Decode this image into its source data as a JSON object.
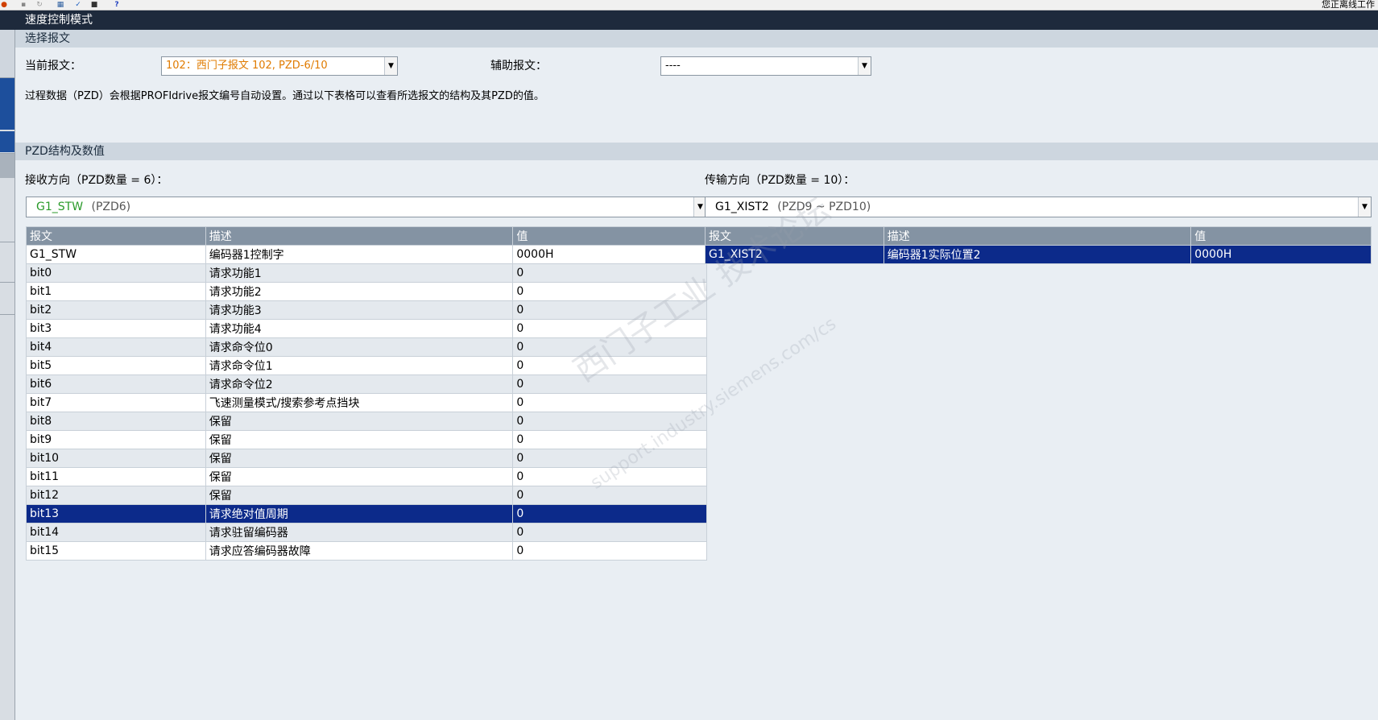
{
  "toolbar": {
    "status": "您正离线工作"
  },
  "title": "速度控制模式",
  "select_section": {
    "header": "选择报文",
    "current_label": "当前报文：",
    "current_value": "102：西门子报文 102, PZD-6/10",
    "aux_label": "辅助报文：",
    "aux_value": "----",
    "info": "过程数据（PZD）会根据PROFIdrive报文编号自动设置。通过以下表格可以查看所选报文的结构及其PZD的值。"
  },
  "pzd_section": {
    "header": "PZD结构及数值",
    "receive": {
      "label": "接收方向（PZD数量 = 6）：",
      "combo_name": "G1_STW",
      "combo_suffix": "(PZD6)",
      "columns": [
        "报文",
        "描述",
        "值"
      ],
      "rows": [
        [
          "G1_STW",
          "编码器1控制字",
          "0000H"
        ],
        [
          "bit0",
          "请求功能1",
          "0"
        ],
        [
          "bit1",
          "请求功能2",
          "0"
        ],
        [
          "bit2",
          "请求功能3",
          "0"
        ],
        [
          "bit3",
          "请求功能4",
          "0"
        ],
        [
          "bit4",
          "请求命令位0",
          "0"
        ],
        [
          "bit5",
          "请求命令位1",
          "0"
        ],
        [
          "bit6",
          "请求命令位2",
          "0"
        ],
        [
          "bit7",
          "飞速测量模式/搜索参考点挡块",
          "0"
        ],
        [
          "bit8",
          "保留",
          "0"
        ],
        [
          "bit9",
          "保留",
          "0"
        ],
        [
          "bit10",
          "保留",
          "0"
        ],
        [
          "bit11",
          "保留",
          "0"
        ],
        [
          "bit12",
          "保留",
          "0"
        ],
        [
          "bit13",
          "请求绝对值周期",
          "0"
        ],
        [
          "bit14",
          "请求驻留编码器",
          "0"
        ],
        [
          "bit15",
          "请求应答编码器故障",
          "0"
        ]
      ],
      "selected_row": 14
    },
    "transmit": {
      "label": "传输方向（PZD数量 = 10）：",
      "combo_name": "G1_XIST2",
      "combo_suffix": "(PZD9 ~ PZD10)",
      "columns": [
        "报文",
        "描述",
        "值"
      ],
      "rows": [
        [
          "G1_XIST2",
          "编码器1实际位置2",
          "0000H"
        ]
      ],
      "selected_row": 0
    }
  },
  "watermark": {
    "line1": "西门子工业 技术论坛",
    "line2": "support.industry.siemens.com/cs"
  },
  "colors": {
    "title_bar": "#1e2a3c",
    "section_header": "#cdd6df",
    "table_header": "#8493a3",
    "selected_row": "#0c2a8a",
    "current_value_text": "#e07b00",
    "combo_name_text": "#2a9a2a"
  }
}
